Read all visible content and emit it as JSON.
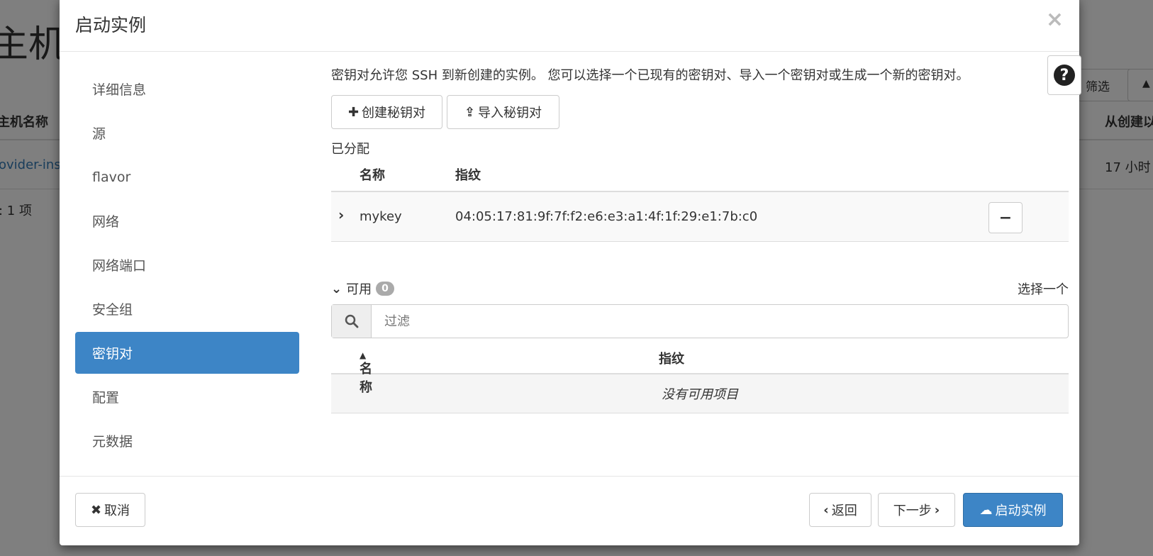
{
  "background": {
    "title": "主机",
    "col_name": "主机名称",
    "row_link": "ovider-ins",
    "count": ": 1 项",
    "filter_button": "筛选",
    "col_created": "从创建以",
    "created_value": "17 小时"
  },
  "modal": {
    "title": "启动实例",
    "close_icon": "×"
  },
  "sidebar": {
    "items": [
      {
        "label": "详细信息"
      },
      {
        "label": "源"
      },
      {
        "label": "flavor"
      },
      {
        "label": "网络"
      },
      {
        "label": "网络端口"
      },
      {
        "label": "安全组"
      },
      {
        "label": "密钥对",
        "active": true
      },
      {
        "label": "配置"
      },
      {
        "label": "元数据"
      }
    ]
  },
  "keypair": {
    "intro": "密钥对允许您 SSH 到新创建的实例。 您可以选择一个已现有的密钥对、导入一个密钥对或生成一个新的密钥对。",
    "create_button": "创建秘钥对",
    "import_button": "导入秘钥对",
    "allocated_label": "已分配",
    "allocated_table": {
      "headers": [
        "名称",
        "指纹"
      ],
      "rows": [
        {
          "name": "mykey",
          "fingerprint": "04:05:17:81:9f:7f:f2:e6:e3:a1:4f:1f:29:e1:7b:c0"
        }
      ]
    },
    "available_label": "可用",
    "available_count": "0",
    "select_one": "选择一个",
    "filter_placeholder": "过滤",
    "available_table": {
      "headers": [
        "名称",
        "指纹"
      ],
      "empty_text": "没有可用项目"
    }
  },
  "footer": {
    "cancel": "取消",
    "back": "返回",
    "next": "下一步",
    "launch": "启动实例"
  },
  "colors": {
    "primary": "#3d85c6",
    "link": "#337ab7"
  }
}
